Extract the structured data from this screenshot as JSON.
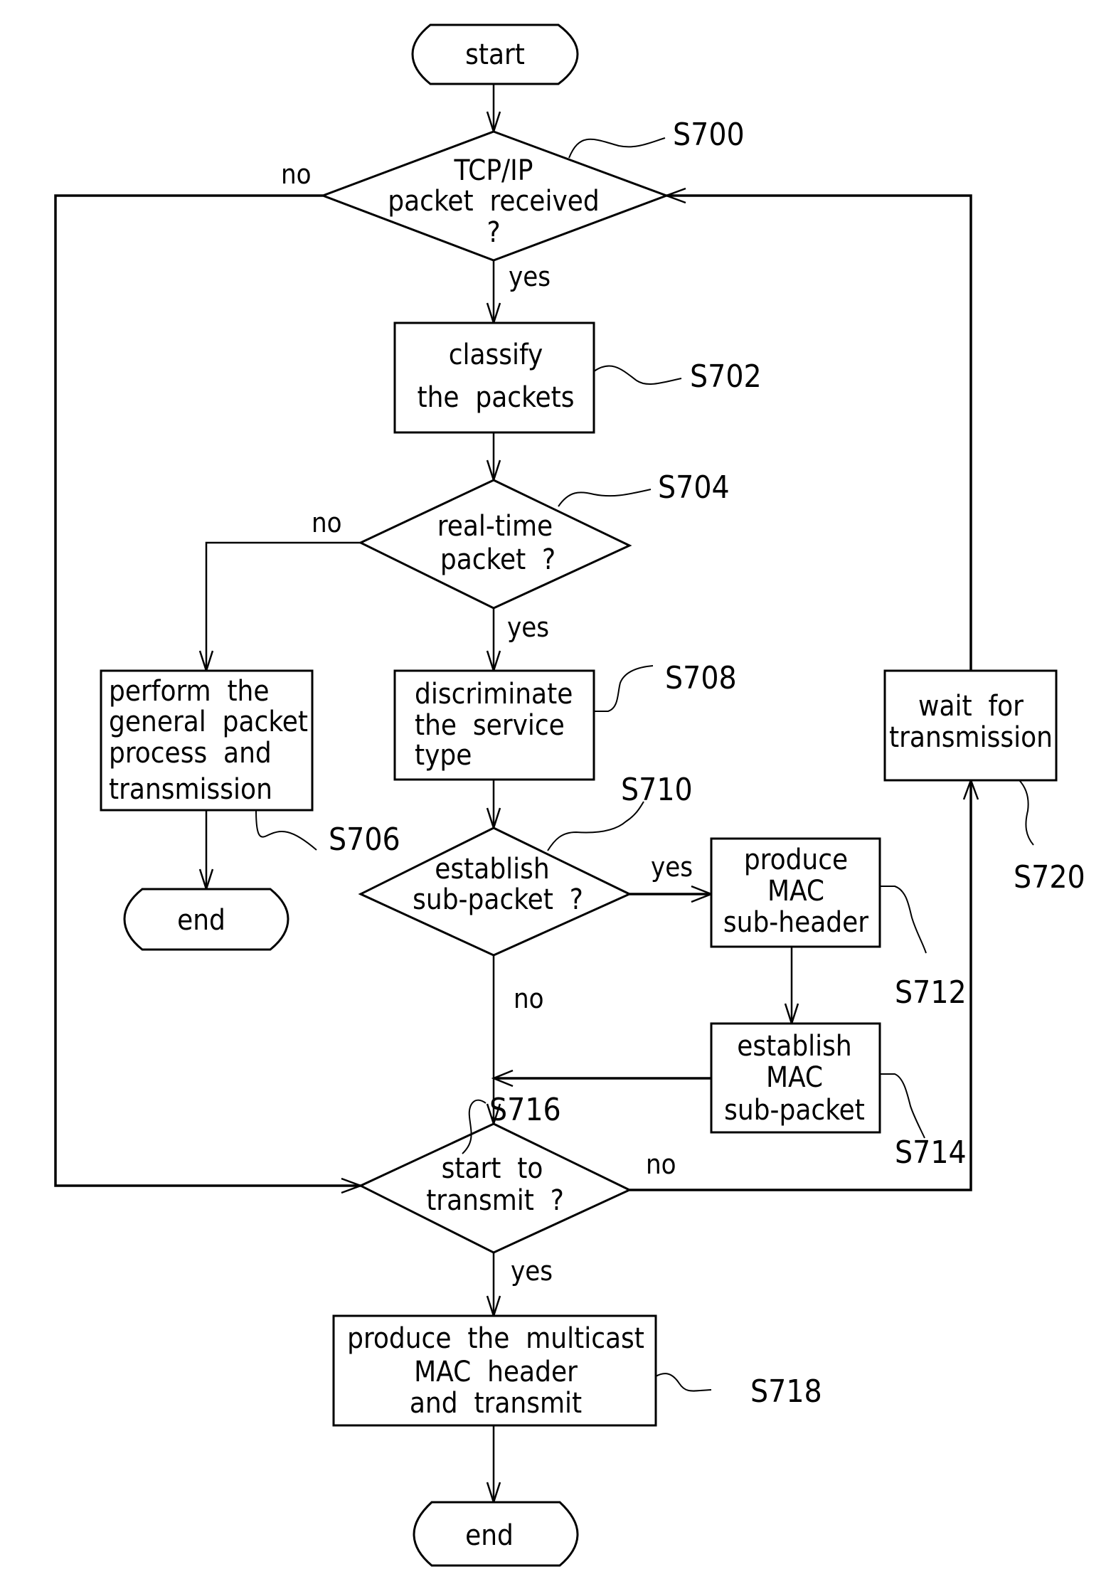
{
  "diagram": {
    "type": "flowchart",
    "colors": {
      "stroke": "#000000",
      "background": "#ffffff"
    },
    "nodes": {
      "start": {
        "kind": "terminator",
        "lines": [
          "start"
        ]
      },
      "s700": {
        "kind": "decision",
        "ref": "S700",
        "lines": [
          "TCP/IP",
          "packet  received",
          "?"
        ]
      },
      "s702": {
        "kind": "process",
        "ref": "S702",
        "lines": [
          "classify",
          "the  packets"
        ]
      },
      "s704": {
        "kind": "decision",
        "ref": "S704",
        "lines": [
          "real-time",
          "packet  ?"
        ]
      },
      "s706": {
        "kind": "process",
        "ref": "S706",
        "lines": [
          "perform  the",
          "general  packet",
          "process  and",
          "transmission"
        ]
      },
      "end_left": {
        "kind": "terminator",
        "lines": [
          "end"
        ]
      },
      "s708": {
        "kind": "process",
        "ref": "S708",
        "lines": [
          "discriminate",
          "the  service",
          "type"
        ]
      },
      "s710": {
        "kind": "decision",
        "ref": "S710",
        "lines": [
          "establish",
          "sub-packet  ?"
        ]
      },
      "s712": {
        "kind": "process",
        "ref": "S712",
        "lines": [
          "produce",
          "MAC",
          "sub-header"
        ]
      },
      "s714": {
        "kind": "process",
        "ref": "S714",
        "lines": [
          "establish",
          "MAC",
          "sub-packet"
        ]
      },
      "s716": {
        "kind": "decision",
        "ref": "S716",
        "lines": [
          "start  to",
          "transmit  ?"
        ]
      },
      "s718": {
        "kind": "process",
        "ref": "S718",
        "lines": [
          "produce  the  multicast",
          "MAC  header",
          "and  transmit"
        ]
      },
      "s720": {
        "kind": "process",
        "ref": "S720",
        "lines": [
          "wait  for",
          "transmission"
        ]
      },
      "end_bottom": {
        "kind": "terminator",
        "lines": [
          "end"
        ]
      }
    },
    "edge_labels": {
      "s700_no": "no",
      "s700_yes": "yes",
      "s704_no": "no",
      "s704_yes": "yes",
      "s710_yes": "yes",
      "s710_no": "no",
      "s716_no": "no",
      "s716_yes": "yes"
    },
    "edges": [
      {
        "from": "start",
        "to": "s700"
      },
      {
        "from": "s700",
        "to": "s702",
        "label": "yes"
      },
      {
        "from": "s700",
        "to": "s716",
        "label": "no"
      },
      {
        "from": "s702",
        "to": "s704"
      },
      {
        "from": "s704",
        "to": "s708",
        "label": "yes"
      },
      {
        "from": "s704",
        "to": "s706",
        "label": "no"
      },
      {
        "from": "s706",
        "to": "end_left"
      },
      {
        "from": "s708",
        "to": "s710"
      },
      {
        "from": "s710",
        "to": "s712",
        "label": "yes"
      },
      {
        "from": "s710",
        "to": "s716",
        "label": "no"
      },
      {
        "from": "s712",
        "to": "s714"
      },
      {
        "from": "s714",
        "to": "s716"
      },
      {
        "from": "s716",
        "to": "s718",
        "label": "yes"
      },
      {
        "from": "s716",
        "to": "s720",
        "label": "no"
      },
      {
        "from": "s720",
        "to": "s700"
      },
      {
        "from": "s718",
        "to": "end_bottom"
      }
    ]
  }
}
